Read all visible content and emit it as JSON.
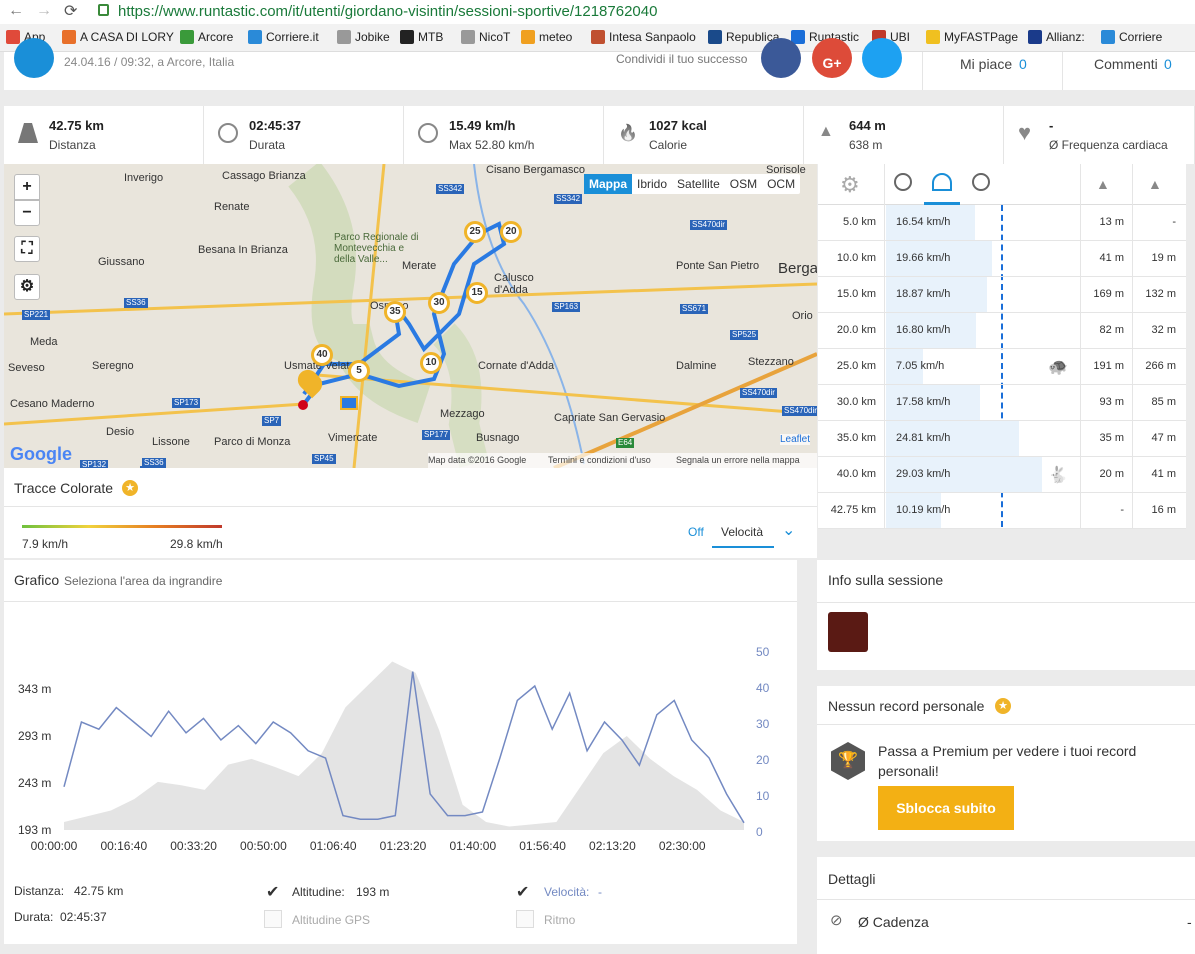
{
  "browser": {
    "url": "https://www.runtastic.com/it/utenti/giordano-visintin/sessioni-sportive/1218762040"
  },
  "bookmarks": [
    "App",
    "A CASA DI LORY",
    "Arcore",
    "Corriere.it",
    "Jobike",
    "MTB",
    "NicoT",
    "meteo",
    "Intesa Sanpaolo",
    "Republica",
    "Runtastic",
    "UBI",
    "MyFASTPage",
    "Allianz:",
    "Corriere"
  ],
  "header": {
    "date_place": "24.04.16 / 09:32, a Arcore, Italia",
    "share": "Condividi il tuo successo",
    "likes_label": "Mi piace",
    "likes": "0",
    "comments_label": "Commenti",
    "comments": "0"
  },
  "stats": [
    {
      "value": "42.75 km",
      "label": "Distanza",
      "icon": "road-icon"
    },
    {
      "value": "02:45:37",
      "label": "Durata",
      "icon": "stopwatch-icon"
    },
    {
      "value": "15.49 km/h",
      "label": "Max 52.80 km/h",
      "icon": "speedometer-icon"
    },
    {
      "value": "1027 kcal",
      "label": "Calorie",
      "icon": "flame-icon"
    },
    {
      "value": "644 m",
      "label": "638 m",
      "icon": "elevation-icon"
    },
    {
      "value": "-",
      "label": "Ø Frequenza cardiaca",
      "icon": "heart-icon"
    }
  ],
  "map": {
    "layers": [
      "Mappa",
      "Ibrido",
      "Satellite",
      "OSM",
      "OCM"
    ],
    "active_layer": "Mappa",
    "attribution": "Map data ©2016 Google",
    "terms": "Termini e condizioni d'uso",
    "report": "Segnala un errore nella mappa",
    "leaflet": "Leaflet",
    "google": "Google",
    "places": [
      "Inverigo",
      "Cassago Brianza",
      "Renate",
      "Cisano Bergamasco",
      "Sorisole",
      "Giussano",
      "Besana In Brianza",
      "Parco Regionale di Montevecchia e della Valle...",
      "Merate",
      "Calusco d'Adda",
      "Ponte San Pietro",
      "Berga",
      "Meda",
      "Seregno",
      "Usmate Velate",
      "Osnago",
      "Cornate d'Adda",
      "Dalmine",
      "Stezzano",
      "Seveso",
      "Cesano Maderno",
      "Desio",
      "Lissone",
      "Parco di Monza",
      "Vimercate",
      "Mezzago",
      "Busnago",
      "Capriate San Gervasio",
      "Orio"
    ],
    "roads": [
      "SS342",
      "SS342",
      "SS470dir",
      "SS36",
      "SP221",
      "SS36",
      "SP163",
      "SS671",
      "SP525",
      "SS470dir",
      "SP173",
      "SP7",
      "SP177",
      "SS470dir",
      "SP132",
      "SS36",
      "SP45",
      "E64"
    ],
    "markers": [
      "5",
      "10",
      "15",
      "20",
      "25",
      "30",
      "35",
      "40"
    ]
  },
  "splits": {
    "headers_icons": [
      "gear-icon",
      "pace-icon",
      "speed-icon",
      "time-icon",
      "ascent-icon",
      "descent-icon"
    ],
    "rows": [
      {
        "km": "5.0 km",
        "speed": "16.54 km/h",
        "up": "13 m",
        "down": "-",
        "fill": 0.57
      },
      {
        "km": "10.0 km",
        "speed": "19.66 km/h",
        "up": "41 m",
        "down": "19 m",
        "fill": 0.68
      },
      {
        "km": "15.0 km",
        "speed": "18.87 km/h",
        "up": "169 m",
        "down": "132 m",
        "fill": 0.65
      },
      {
        "km": "20.0 km",
        "speed": "16.80 km/h",
        "up": "82 m",
        "down": "32 m",
        "fill": 0.58
      },
      {
        "km": "25.0 km",
        "speed": "7.05 km/h",
        "up": "191 m",
        "down": "266 m",
        "fill": 0.24,
        "badge": "turtle-icon"
      },
      {
        "km": "30.0 km",
        "speed": "17.58 km/h",
        "up": "93 m",
        "down": "85 m",
        "fill": 0.6
      },
      {
        "km": "35.0 km",
        "speed": "24.81 km/h",
        "up": "35 m",
        "down": "47 m",
        "fill": 0.85
      },
      {
        "km": "40.0 km",
        "speed": "29.03 km/h",
        "up": "20 m",
        "down": "41 m",
        "fill": 1.0,
        "badge": "rabbit-icon"
      },
      {
        "km": "42.75 km",
        "speed": "10.19 km/h",
        "up": "-",
        "down": "16 m",
        "fill": 0.35
      }
    ]
  },
  "colored": {
    "title": "Tracce Colorate",
    "min": "7.9 km/h",
    "max": "29.8 km/h",
    "off": "Off",
    "sel": "Velocità"
  },
  "chart": {
    "title": "Grafico",
    "hint": "Seleziona l'area da ingrandire"
  },
  "chart_data": {
    "type": "line",
    "title": "",
    "x_ticks": [
      "00:00:00",
      "00:16:40",
      "00:33:20",
      "00:50:00",
      "01:06:40",
      "01:23:20",
      "01:40:00",
      "01:56:40",
      "02:13:20",
      "02:30:00"
    ],
    "y_left_ticks": [
      "343 m",
      "293 m",
      "243 m",
      "193 m"
    ],
    "y_right_ticks": [
      "50",
      "40",
      "30",
      "20",
      "10",
      "0"
    ],
    "series": [
      {
        "name": "Altitudine",
        "values": [
          200,
          205,
          210,
          220,
          235,
          232,
          228,
          250,
          255,
          248,
          240,
          260,
          300,
          320,
          340,
          330,
          280,
          215,
          200,
          196,
          198,
          200,
          230,
          260,
          275,
          255,
          240,
          228,
          210,
          200
        ]
      },
      {
        "name": "Velocità",
        "values": [
          12,
          30,
          28,
          34,
          30,
          26,
          33,
          27,
          31,
          25,
          29,
          24,
          30,
          27,
          22,
          20,
          4,
          3,
          3,
          4,
          44,
          10,
          4,
          4,
          5,
          20,
          36,
          40,
          28,
          38,
          22,
          30,
          25,
          18,
          32,
          36,
          25,
          20,
          10,
          2
        ]
      }
    ]
  },
  "legend": {
    "dist": "Distanza:",
    "dist_v": "42.75 km",
    "dur": "Durata:",
    "dur_v": "02:45:37",
    "alt": "Altitudine:",
    "alt_v": "193 m",
    "gps": "Altitudine GPS",
    "vel": "Velocità:",
    "vel_v": "-",
    "ritmo": "Ritmo"
  },
  "side": {
    "info": "Info sulla sessione",
    "records": "Nessun record personale",
    "premium": "Passa a Premium per vedere i tuoi record personali!",
    "unlock": "Sblocca subito",
    "details": "Dettagli",
    "cad": "Ø Cadenza",
    "cad_v": "-"
  }
}
